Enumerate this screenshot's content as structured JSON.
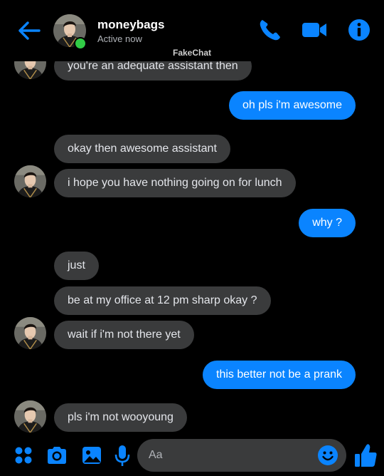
{
  "header": {
    "contact_name": "moneybags",
    "status": "Active now",
    "watermark": "FakeChat"
  },
  "messages": [
    {
      "from": "them",
      "text": "you're an adequate assistant then"
    },
    {
      "from": "me",
      "text": "oh pls i'm awesome"
    },
    {
      "from": "them",
      "text": "okay then awesome assistant"
    },
    {
      "from": "them",
      "text": "i hope you have nothing going on for lunch"
    },
    {
      "from": "me",
      "text": "why ?"
    },
    {
      "from": "them",
      "text": "just"
    },
    {
      "from": "them",
      "text": "be at my office at 12 pm sharp okay ?"
    },
    {
      "from": "them",
      "text": "wait if i'm not there yet"
    },
    {
      "from": "me",
      "text": "this better not be a prank"
    },
    {
      "from": "them",
      "text": "pls i'm not wooyoung"
    }
  ],
  "composer": {
    "placeholder": "Aa"
  },
  "colors": {
    "accent": "#0a84ff",
    "incoming_bubble": "#3a3b3c",
    "online": "#31cc46",
    "background": "#000000"
  },
  "icons": {
    "back": "arrow-left-icon",
    "call": "phone-icon",
    "video": "video-camera-icon",
    "info": "info-icon",
    "apps": "four-dots-icon",
    "camera": "camera-icon",
    "gallery": "image-icon",
    "mic": "microphone-icon",
    "emoji": "smiley-icon",
    "like": "thumbs-up-icon"
  }
}
